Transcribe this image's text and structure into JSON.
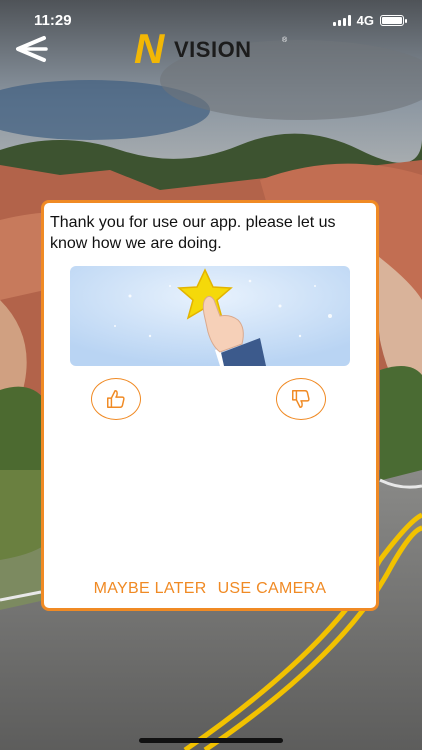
{
  "status_bar": {
    "time": "11:29",
    "network": "4G",
    "battery_level": 1.0
  },
  "header": {
    "back_icon": "chevron-left-icon",
    "logo": {
      "letter": "N",
      "word": "VISION",
      "registered": "®"
    }
  },
  "dialog": {
    "message": "Thank you for use our app. please let us know how we are doing.",
    "image_icon": "star-tap-icon",
    "thumbs_up_icon": "thumbs-up-icon",
    "thumbs_down_icon": "thumbs-down-icon",
    "maybe_later_label": "MAYBE LATER",
    "use_camera_label": "USE CAMERA"
  },
  "colors": {
    "accent": "#f08a24",
    "logo_yellow": "#f2b705",
    "image_bg": "#cfe2f8"
  }
}
